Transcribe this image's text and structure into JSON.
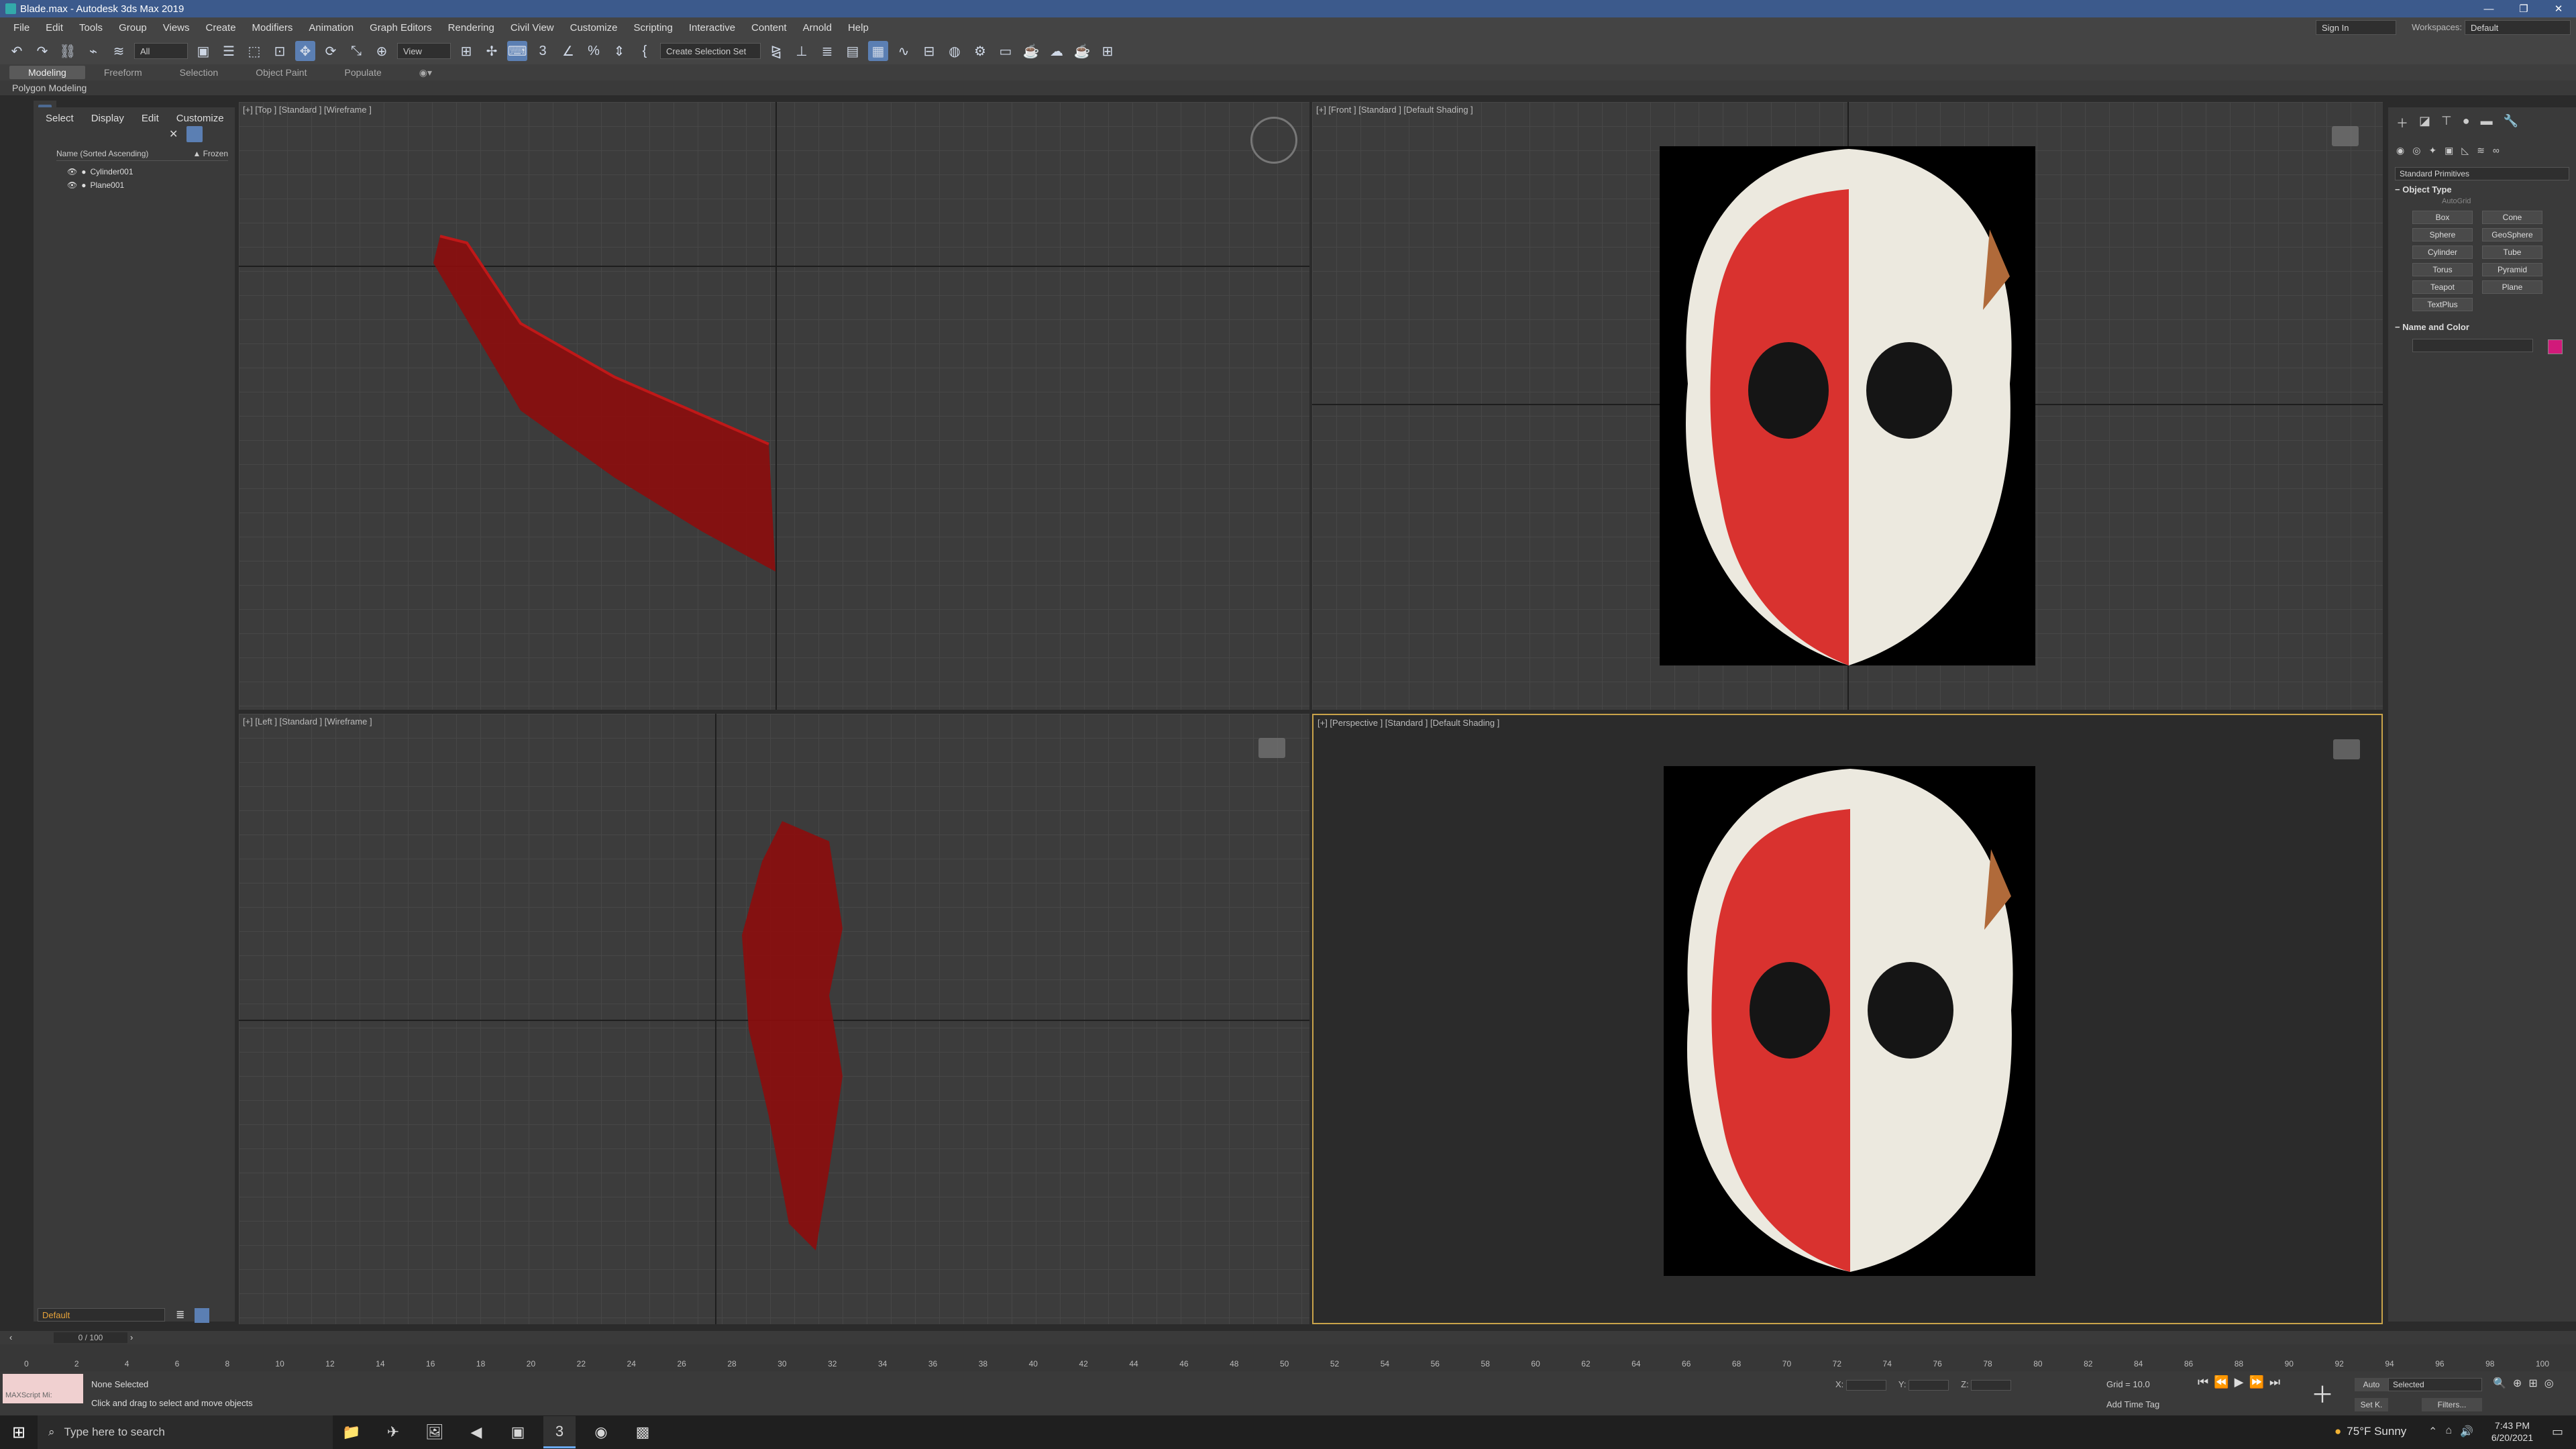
{
  "window": {
    "title": "Blade.max - Autodesk 3ds Max 2019",
    "controls": [
      "—",
      "❐",
      "✕"
    ]
  },
  "menu": {
    "items": [
      "File",
      "Edit",
      "Tools",
      "Group",
      "Views",
      "Create",
      "Modifiers",
      "Animation",
      "Graph Editors",
      "Rendering",
      "Civil View",
      "Customize",
      "Scripting",
      "Interactive",
      "Content",
      "Arnold",
      "Help"
    ],
    "sign_in": "Sign In",
    "workspaces_label": "Workspaces:",
    "workspaces_value": "Default"
  },
  "toolbar": {
    "filter_all": "All",
    "view": "View",
    "selection_set": "Create Selection Set"
  },
  "ribbon": {
    "tabs": [
      "Modeling",
      "Freeform",
      "Selection",
      "Object Paint",
      "Populate"
    ],
    "sub": "Polygon Modeling"
  },
  "scene_explorer": {
    "tabs": [
      "Select",
      "Display",
      "Edit",
      "Customize"
    ],
    "col_name": "Name (Sorted Ascending)",
    "col_frozen": "▲ Frozen",
    "items": [
      "Cylinder001",
      "Plane001"
    ]
  },
  "viewports": {
    "top": "[+] [Top ] [Standard ] [Wireframe ]",
    "front": "[+] [Front ] [Standard ] [Default Shading ]",
    "left": "[+] [Left ] [Standard ] [Wireframe ]",
    "perspective": "[+] [Perspective ] [Standard ] [Default Shading ]"
  },
  "command_panel": {
    "category": "Standard Primitives",
    "object_type": "Object Type",
    "autogrid": "AutoGrid",
    "buttons": [
      "Box",
      "Cone",
      "Sphere",
      "GeoSphere",
      "Cylinder",
      "Tube",
      "Torus",
      "Pyramid",
      "Teapot",
      "Plane",
      "TextPlus"
    ],
    "name_and_color": "Name and Color",
    "color": "#d11a7a"
  },
  "layer": {
    "value": "Default"
  },
  "timeline": {
    "frame": "0 / 100",
    "ticks": [
      "0",
      "2",
      "4",
      "6",
      "8",
      "10",
      "12",
      "14",
      "16",
      "18",
      "20",
      "22",
      "24",
      "26",
      "28",
      "30",
      "32",
      "34",
      "36",
      "38",
      "40",
      "42",
      "44",
      "46",
      "48",
      "50",
      "52",
      "54",
      "56",
      "58",
      "60",
      "62",
      "64",
      "66",
      "68",
      "70",
      "72",
      "74",
      "76",
      "78",
      "80",
      "82",
      "84",
      "86",
      "88",
      "90",
      "92",
      "94",
      "96",
      "98",
      "100"
    ]
  },
  "status": {
    "maxscript": "MAXScript Mi:",
    "selection": "None Selected",
    "hint": "Click and drag to select and move objects",
    "x": "X:",
    "y": "Y:",
    "z": "Z:",
    "grid": "Grid = 10.0",
    "add_time_tag": "Add Time Tag",
    "auto": "Auto",
    "selected": "Selected",
    "set_k": "Set K.",
    "filters": "Filters..."
  },
  "taskbar": {
    "search": "Type here to search",
    "weather": "75°F Sunny",
    "time": "7:43 PM",
    "date": "6/20/2021"
  }
}
